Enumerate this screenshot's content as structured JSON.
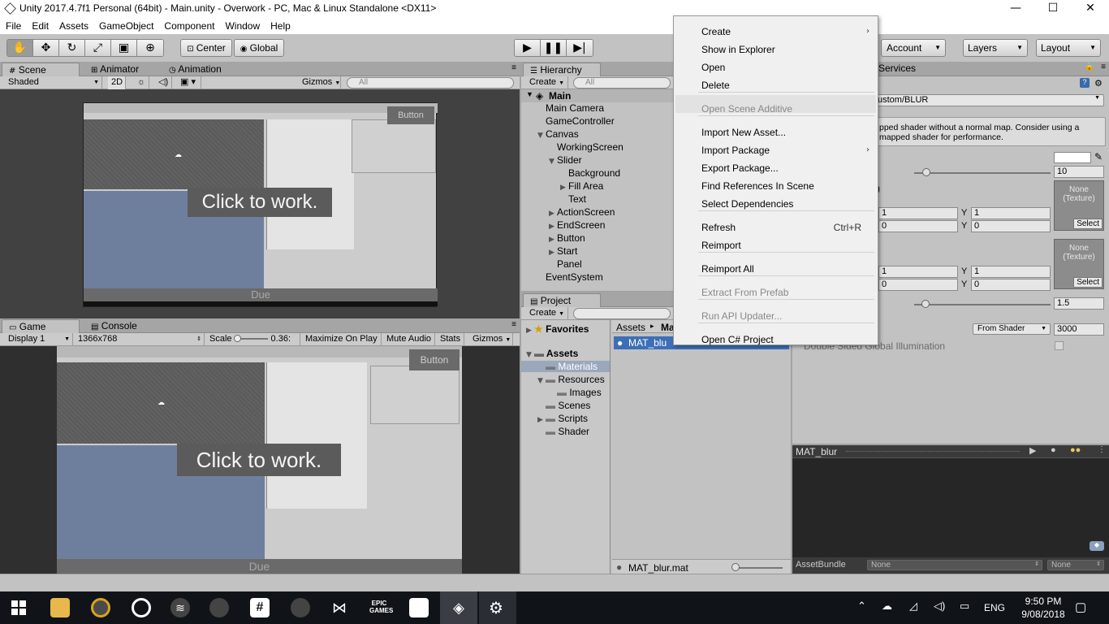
{
  "window": {
    "title": "Unity 2017.4.7f1 Personal (64bit) - Main.unity - Overwork - PC, Mac & Linux Standalone <DX11>",
    "minimize": "—",
    "maximize": "☐",
    "close": "✕"
  },
  "menu": [
    "File",
    "Edit",
    "Assets",
    "GameObject",
    "Component",
    "Window",
    "Help"
  ],
  "toolbar": {
    "pivot": "Center",
    "space": "Global",
    "account": "Account",
    "layers": "Layers",
    "layout": "Layout",
    "services": "Services",
    "play_icon": "play-icon",
    "pause_icon": "pause-icon",
    "step_icon": "step-icon"
  },
  "scene_panel": {
    "tabs": [
      "Scene",
      "Animator",
      "Animation"
    ],
    "shading": "Shaded",
    "mode_2d": "2D",
    "gizmos": "Gizmos",
    "search_placeholder": "All",
    "overlay_button": "Button",
    "click_text": "Click to work.",
    "due_text": "Due"
  },
  "game_panel": {
    "tabs": [
      "Game",
      "Console"
    ],
    "display": "Display 1",
    "resolution": "1366x768",
    "scale_label": "Scale",
    "scale_value": "0.36:",
    "maximize": "Maximize On Play",
    "mute": "Mute Audio",
    "stats": "Stats",
    "gizmos": "Gizmos",
    "overlay_button": "Button",
    "click_text": "Click to work.",
    "due_text": "Due"
  },
  "hierarchy": {
    "tab": "Hierarchy",
    "create": "Create",
    "search_placeholder": "All",
    "scene": "Main",
    "items": [
      {
        "label": "Main Camera",
        "indent": 0,
        "arrow": ""
      },
      {
        "label": "GameController",
        "indent": 0,
        "arrow": ""
      },
      {
        "label": "Canvas",
        "indent": 0,
        "arrow": "▼"
      },
      {
        "label": "WorkingScreen",
        "indent": 1,
        "arrow": ""
      },
      {
        "label": "Slider",
        "indent": 1,
        "arrow": "▼"
      },
      {
        "label": "Background",
        "indent": 2,
        "arrow": ""
      },
      {
        "label": "Fill Area",
        "indent": 2,
        "arrow": "▶"
      },
      {
        "label": "Text",
        "indent": 2,
        "arrow": ""
      },
      {
        "label": "ActionScreen",
        "indent": 1,
        "arrow": "▶"
      },
      {
        "label": "EndScreen",
        "indent": 1,
        "arrow": "▶"
      },
      {
        "label": "Button",
        "indent": 1,
        "arrow": "▶"
      },
      {
        "label": "Start",
        "indent": 1,
        "arrow": "▶"
      },
      {
        "label": "Panel",
        "indent": 1,
        "arrow": ""
      },
      {
        "label": "EventSystem",
        "indent": 0,
        "arrow": ""
      }
    ]
  },
  "project": {
    "tab": "Project",
    "create": "Create",
    "favorites": "Favorites",
    "assets": "Assets",
    "folders": [
      {
        "label": "Materials",
        "indent": 1,
        "arrow": ""
      },
      {
        "label": "Resources",
        "indent": 1,
        "arrow": "▼"
      },
      {
        "label": "Images",
        "indent": 2,
        "arrow": ""
      },
      {
        "label": "Scenes",
        "indent": 1,
        "arrow": ""
      },
      {
        "label": "Scripts",
        "indent": 1,
        "arrow": "▶"
      },
      {
        "label": "Shader",
        "indent": 1,
        "arrow": ""
      }
    ],
    "breadcrumb_root": "Assets",
    "breadcrumb_sep": "▸",
    "breadcrumb_folder": "Ma",
    "selected_file": "MAT_blu",
    "footer_file": "MAT_blur.mat"
  },
  "inspector": {
    "shader": "ustom/BLUR",
    "warning_line1": "pped shader without a normal map. Consider using a",
    "warning_line2": "mapped shader for performance.",
    "val_10": "10",
    "paren": ")",
    "tex_none": "None",
    "tex_type": "(Texture)",
    "select": "Select",
    "x1": "1",
    "y_label": "Y",
    "y1": "1",
    "x0": "0",
    "y0": "0",
    "val_15": "1.5",
    "from_shader": "From Shader",
    "render_queue": "3000",
    "double_sided": "Double Sided Global Illumination",
    "preview_title": "MAT_blur",
    "assetbundle_label": "AssetBundle",
    "none1": "None",
    "none2": "None"
  },
  "context_menu": [
    {
      "label": "Create",
      "submenu": true,
      "disabled": false
    },
    {
      "label": "Show in Explorer",
      "disabled": false
    },
    {
      "label": "Open",
      "disabled": false
    },
    {
      "label": "Delete",
      "disabled": false
    },
    {
      "label": "Open Scene Additive",
      "disabled": true
    },
    {
      "label": "Import New Asset...",
      "disabled": false
    },
    {
      "label": "Import Package",
      "submenu": true,
      "disabled": false
    },
    {
      "label": "Export Package...",
      "disabled": false
    },
    {
      "label": "Find References In Scene",
      "disabled": false
    },
    {
      "label": "Select Dependencies",
      "disabled": false
    },
    {
      "label": "Refresh",
      "shortcut": "Ctrl+R",
      "disabled": false
    },
    {
      "label": "Reimport",
      "disabled": false
    },
    {
      "label": "Reimport All",
      "disabled": false
    },
    {
      "label": "Extract From Prefab",
      "disabled": true
    },
    {
      "label": "Run API Updater...",
      "disabled": true
    },
    {
      "label": "Open C# Project",
      "disabled": false
    }
  ],
  "taskbar": {
    "lang": "ENG",
    "time": "9:50 PM",
    "date": "9/08/2018",
    "epic_line1": "EPIC",
    "epic_line2": "GAMES"
  }
}
